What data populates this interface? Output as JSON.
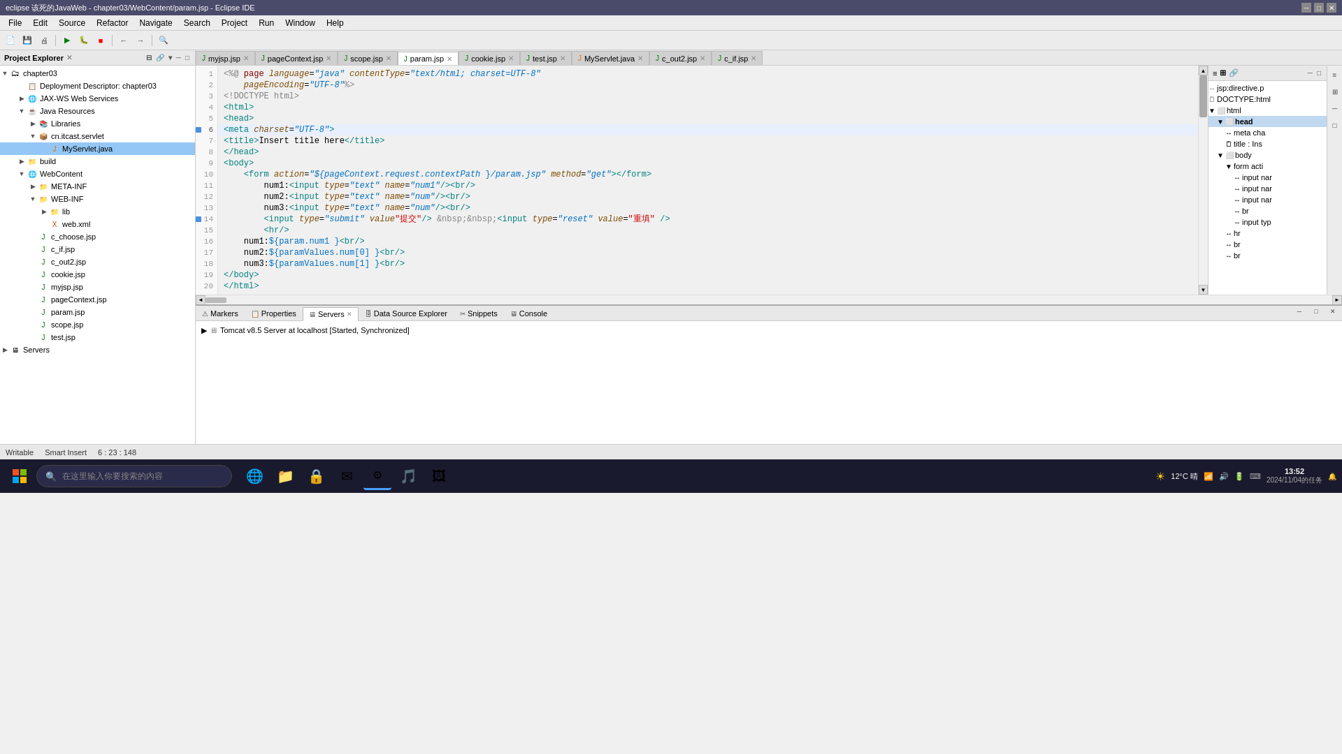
{
  "window": {
    "title": "eclipse 该死的JavaWeb - chapter03/WebContent/param.jsp - Eclipse IDE",
    "min_btn": "─",
    "max_btn": "□",
    "close_btn": "✕"
  },
  "menu": {
    "items": [
      "File",
      "Edit",
      "Source",
      "Refactor",
      "Navigate",
      "Search",
      "Project",
      "Run",
      "Window",
      "Help"
    ]
  },
  "tabs": [
    {
      "label": "myjsp.jsp",
      "active": false
    },
    {
      "label": "pageContext.jsp",
      "active": false
    },
    {
      "label": "scope.jsp",
      "active": false
    },
    {
      "label": "param.jsp",
      "active": true
    },
    {
      "label": "cookie.jsp",
      "active": false
    },
    {
      "label": "test.jsp",
      "active": false
    },
    {
      "label": "MyServlet.java",
      "active": false
    },
    {
      "label": "c_out2.jsp",
      "active": false
    },
    {
      "label": "c_if.jsp",
      "active": false
    }
  ],
  "sidebar": {
    "title": "Project Explorer",
    "items": [
      {
        "label": "chapter03",
        "indent": 0,
        "type": "project",
        "icon": "📁",
        "expanded": true
      },
      {
        "label": "Deployment Descriptor: chapter03",
        "indent": 1,
        "type": "folder",
        "icon": "📄"
      },
      {
        "label": "JAX-WS Web Services",
        "indent": 1,
        "type": "folder",
        "icon": "📁"
      },
      {
        "label": "Java Resources",
        "indent": 1,
        "type": "folder",
        "icon": "📁",
        "expanded": true
      },
      {
        "label": "Libraries",
        "indent": 2,
        "type": "folder",
        "icon": "📁"
      },
      {
        "label": "cn.itcast.servlet",
        "indent": 2,
        "type": "package",
        "icon": "📦",
        "expanded": true
      },
      {
        "label": "MyServlet.java",
        "indent": 3,
        "type": "java",
        "icon": "J",
        "selected": true
      },
      {
        "label": "build",
        "indent": 1,
        "type": "folder",
        "icon": "📁"
      },
      {
        "label": "WebContent",
        "indent": 1,
        "type": "folder",
        "icon": "📁",
        "expanded": true
      },
      {
        "label": "META-INF",
        "indent": 2,
        "type": "folder",
        "icon": "📁"
      },
      {
        "label": "WEB-INF",
        "indent": 2,
        "type": "folder",
        "icon": "📁",
        "expanded": true
      },
      {
        "label": "lib",
        "indent": 3,
        "type": "folder",
        "icon": "📁"
      },
      {
        "label": "web.xml",
        "indent": 3,
        "type": "xml",
        "icon": "X"
      },
      {
        "label": "c_choose.jsp",
        "indent": 2,
        "type": "jsp",
        "icon": "J"
      },
      {
        "label": "c_if.jsp",
        "indent": 2,
        "type": "jsp",
        "icon": "J"
      },
      {
        "label": "c_out2.jsp",
        "indent": 2,
        "type": "jsp",
        "icon": "J"
      },
      {
        "label": "cookie.jsp",
        "indent": 2,
        "type": "jsp",
        "icon": "J"
      },
      {
        "label": "myjsp.jsp",
        "indent": 2,
        "type": "jsp",
        "icon": "J"
      },
      {
        "label": "pageContext.jsp",
        "indent": 2,
        "type": "jsp",
        "icon": "J"
      },
      {
        "label": "param.jsp",
        "indent": 2,
        "type": "jsp",
        "icon": "J"
      },
      {
        "label": "scope.jsp",
        "indent": 2,
        "type": "jsp",
        "icon": "J"
      },
      {
        "label": "test.jsp",
        "indent": 2,
        "type": "jsp",
        "icon": "J"
      },
      {
        "label": "Servers",
        "indent": 0,
        "type": "folder",
        "icon": "📁"
      }
    ]
  },
  "code": {
    "lines": [
      {
        "num": 1,
        "content": "<%@ page language=\"java\" contentType=\"text/html; charset=UTF-8\"",
        "marker": false
      },
      {
        "num": 2,
        "content": "    pageEncoding=\"UTF-8\"%>",
        "marker": false
      },
      {
        "num": 3,
        "content": "<!DOCTYPE html>",
        "marker": false
      },
      {
        "num": 4,
        "content": "<html>",
        "marker": false
      },
      {
        "num": 5,
        "content": "<head>",
        "marker": false
      },
      {
        "num": 6,
        "content": "<meta charset=\"UTF-8\">",
        "marker": true,
        "highlighted": true
      },
      {
        "num": 7,
        "content": "<title>Insert title here</title>",
        "marker": false
      },
      {
        "num": 8,
        "content": "</head>",
        "marker": false
      },
      {
        "num": 9,
        "content": "<body>",
        "marker": false
      },
      {
        "num": 10,
        "content": "    <form action=\"${pageContext.request.contextPath }/param.jsp\" method=\"get\"></form>",
        "marker": false
      },
      {
        "num": 11,
        "content": "        num1:<input type=\"text\" name=\"num1\"/><br/>",
        "marker": false
      },
      {
        "num": 12,
        "content": "        num2:<input type=\"text\" name=\"num\"/><br/>",
        "marker": false
      },
      {
        "num": 13,
        "content": "        num3:<input type=\"text\" name=\"num\"/><br/>",
        "marker": false
      },
      {
        "num": 14,
        "content": "        <input type=\"submit\" value=\"提交\"/> &nbsp;&nbsp;<input type=\"reset\" value=\"重填\" />",
        "marker": true
      },
      {
        "num": 15,
        "content": "        <hr/>",
        "marker": false
      },
      {
        "num": 16,
        "content": "    num1:${param.num1 }<br/>",
        "marker": false
      },
      {
        "num": 17,
        "content": "    num2:${paramValues.num[0] }<br/>",
        "marker": false
      },
      {
        "num": 18,
        "content": "    num3:${paramValues.num[1] }<br/>",
        "marker": false
      },
      {
        "num": 19,
        "content": "</body>",
        "marker": false
      },
      {
        "num": 20,
        "content": "</html>",
        "marker": false
      }
    ]
  },
  "outline": {
    "title": "head",
    "items": [
      {
        "label": "jsp:directive.p",
        "indent": 0
      },
      {
        "label": "DOCTYPE:html",
        "indent": 0
      },
      {
        "label": "html",
        "indent": 0,
        "expanded": true
      },
      {
        "label": "head",
        "indent": 1,
        "expanded": true,
        "selected": true
      },
      {
        "label": "meta cha",
        "indent": 2
      },
      {
        "label": "title : Ins",
        "indent": 2
      },
      {
        "label": "body",
        "indent": 1,
        "expanded": true
      },
      {
        "label": "form acti",
        "indent": 2
      },
      {
        "label": "input nar",
        "indent": 3
      },
      {
        "label": "input nar",
        "indent": 3
      },
      {
        "label": "input nar",
        "indent": 3
      },
      {
        "label": "br",
        "indent": 3
      },
      {
        "label": "input typ",
        "indent": 3
      },
      {
        "label": "hr",
        "indent": 2
      },
      {
        "label": "br",
        "indent": 2
      },
      {
        "label": "br",
        "indent": 2
      }
    ]
  },
  "bottom_panel": {
    "tabs": [
      "Markers",
      "Properties",
      "Servers",
      "Data Source Explorer",
      "Snippets",
      "Console"
    ],
    "active_tab": "Servers",
    "server": "Tomcat v8.5 Server at localhost  [Started, Synchronized]"
  },
  "status_bar": {
    "writable": "Writable",
    "smart_insert": "Smart Insert",
    "position": "6 : 23 : 148"
  },
  "taskbar": {
    "search_placeholder": "在这里输入你要搜索的内容",
    "time": "13:52",
    "date": "2024/11/04的任务",
    "weather": "12°C 晴",
    "apps": [
      "🌐",
      "📁",
      "🔒",
      "✉",
      "⚙",
      "🎵",
      "🖼"
    ]
  }
}
